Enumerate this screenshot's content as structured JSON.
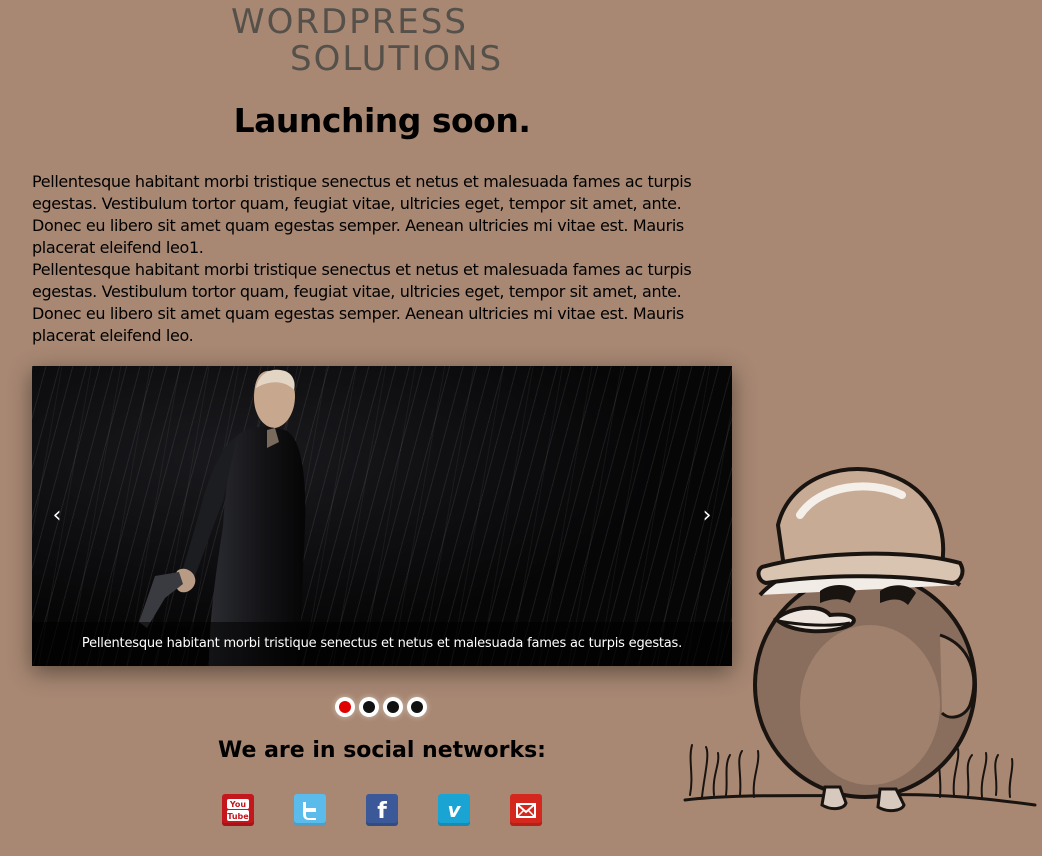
{
  "logo": {
    "line1": "WORDPRESS",
    "line2": "SOLUTIONS"
  },
  "headline": "Launching soon.",
  "intro": [
    "Pellentesque habitant morbi tristique senectus et netus et malesuada fames ac turpis egestas. Vestibulum tortor quam, feugiat vitae, ultricies eget, tempor sit amet, ante. Donec eu libero sit amet quam egestas semper. Aenean ultricies mi vitae est. Mauris placerat eleifend leo1.",
    "Pellentesque habitant morbi tristique senectus et netus et malesuada fames ac turpis egestas. Vestibulum tortor quam, feugiat vitae, ultricies eget, tempor sit amet, ante. Donec eu libero sit amet quam egestas semper. Aenean ultricies mi vitae est. Mauris placerat eleifend leo."
  ],
  "slider": {
    "prev": "‹",
    "next": "›",
    "caption": "Pellentesque habitant morbi tristique senectus et netus et malesuada fames ac turpis egestas.",
    "slide_count": 4,
    "active_slide": 1
  },
  "social": {
    "title": "We are in social networks:",
    "icons": [
      {
        "name": "youtube-icon",
        "color": "#c4171d",
        "text_top": "You",
        "text_bottom": "Tube"
      },
      {
        "name": "twitter-icon",
        "color": "#5bbbea"
      },
      {
        "name": "facebook-icon",
        "color": "#3b5998",
        "text": "f"
      },
      {
        "name": "vimeo-icon",
        "color": "#1aa4d4",
        "text": "v"
      },
      {
        "name": "email-icon",
        "color": "#d4271e"
      }
    ]
  },
  "colors": {
    "background": "#a88873",
    "logo": "#55504a",
    "active_dot": "#e00000"
  }
}
